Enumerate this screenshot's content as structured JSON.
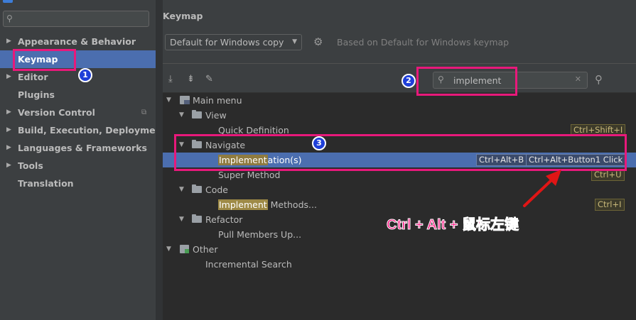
{
  "sidebar": {
    "search": {
      "placeholder": "",
      "icon": "search-icon"
    },
    "items": [
      {
        "label": "Appearance & Behavior",
        "expandable": true,
        "selected": false
      },
      {
        "label": "Keymap",
        "expandable": false,
        "selected": true
      },
      {
        "label": "Editor",
        "expandable": true,
        "selected": false
      },
      {
        "label": "Plugins",
        "expandable": false,
        "selected": false
      },
      {
        "label": "Version Control",
        "expandable": true,
        "selected": false,
        "icon": "copy-icon"
      },
      {
        "label": "Build, Execution, Deployment",
        "expandable": true,
        "selected": false
      },
      {
        "label": "Languages & Frameworks",
        "expandable": true,
        "selected": false
      },
      {
        "label": "Tools",
        "expandable": true,
        "selected": false
      },
      {
        "label": "Translation",
        "expandable": false,
        "selected": false
      }
    ]
  },
  "main": {
    "title": "Keymap",
    "keymap_select": {
      "value": "Default for Windows copy"
    },
    "based_on": "Based on Default for Windows keymap",
    "search": {
      "value": "implement"
    },
    "tree": [
      {
        "label": "Main menu",
        "type": "menu",
        "expanded": true
      },
      {
        "label": "View",
        "type": "folder",
        "expanded": true
      },
      {
        "label": "Quick Definition",
        "type": "action",
        "shortcuts": [
          "Ctrl+Shift+I"
        ]
      },
      {
        "label": "Navigate",
        "type": "folder",
        "expanded": true
      },
      {
        "label_highlight": "Implement",
        "label_rest": "ation(s)",
        "type": "action",
        "selected": true,
        "shortcuts": [
          "Ctrl+Alt+B",
          "Ctrl+Alt+Button1 Click"
        ]
      },
      {
        "label": "Super Method",
        "type": "action",
        "shortcuts": [
          "Ctrl+U"
        ]
      },
      {
        "label": "Code",
        "type": "folder",
        "expanded": true
      },
      {
        "label_highlight": "Implement",
        "label_rest": " Methods...",
        "type": "action",
        "shortcuts": [
          "Ctrl+I"
        ]
      },
      {
        "label": "Refactor",
        "type": "folder",
        "expanded": true
      },
      {
        "label": "Pull Members Up...",
        "type": "action",
        "shortcuts": []
      },
      {
        "label": "Other",
        "type": "other",
        "expanded": true
      },
      {
        "label": "Incremental Search",
        "type": "action",
        "shortcuts": []
      }
    ]
  },
  "annotations": {
    "badges": [
      "1",
      "2",
      "3"
    ],
    "note": "Ctrl + Alt + 鼠标左键",
    "colors": {
      "box": "#e8197b",
      "badge": "#1f3fd8",
      "arrow": "#e01515"
    }
  },
  "colors": {
    "selection": "#4b6eaf",
    "highlight": "#9e8a46",
    "background": "#3c3f41",
    "tree_bg": "#2b2b2b"
  }
}
